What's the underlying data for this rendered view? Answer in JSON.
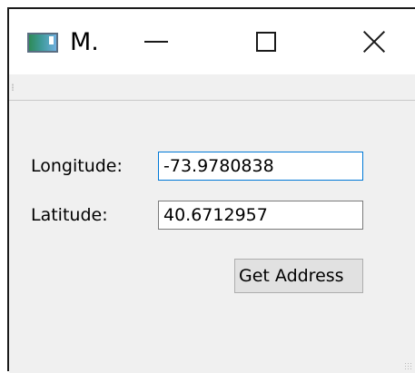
{
  "window": {
    "title": "M.",
    "icon": "app-window-icon",
    "controls": {
      "minimize_icon": "minimize-icon",
      "maximize_icon": "maximize-icon",
      "close_icon": "close-icon"
    }
  },
  "form": {
    "longitude_label": "Longitude:",
    "longitude_value": "-73.9780838",
    "latitude_label": "Latitude:",
    "latitude_value": "40.6712957",
    "get_address_label": "Get Address"
  },
  "colors": {
    "focus_border": "#0078d7",
    "window_background": "#f0f0f0",
    "button_background": "#e1e1e1"
  }
}
